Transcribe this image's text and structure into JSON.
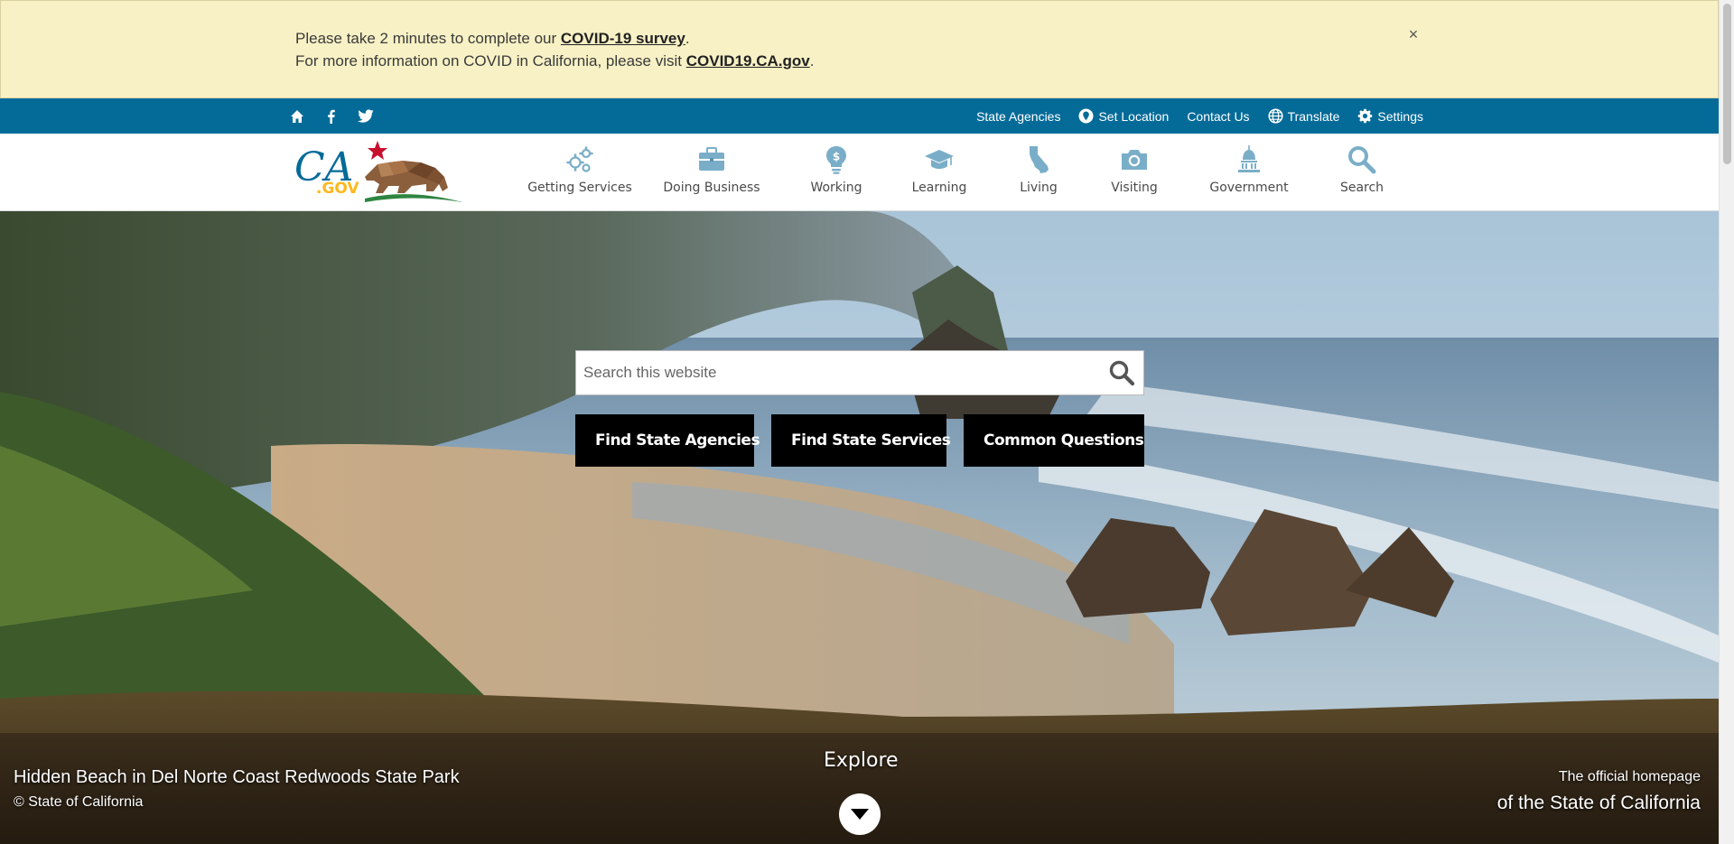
{
  "alert": {
    "line1_prefix": "Please take 2 minutes to complete our ",
    "line1_link": "COVID-19 survey",
    "line1_suffix": ".",
    "line2_prefix": "For more information on COVID in California, please visit ",
    "line2_link": "COVID19.CA.gov",
    "line2_suffix": ".",
    "close_symbol": "×"
  },
  "utility": {
    "social_icons": [
      "home-icon",
      "facebook-icon",
      "twitter-icon"
    ],
    "links": {
      "state_agencies": "State Agencies",
      "set_location": "Set Location",
      "contact_us": "Contact Us",
      "translate": "Translate",
      "settings": "Settings"
    }
  },
  "header": {
    "logo_text": "CA.GOV",
    "logo_ca": "CA",
    "logo_gov": ".GOV",
    "nav": [
      {
        "label": "Getting Services",
        "icon": "gears-icon"
      },
      {
        "label": "Doing Business",
        "icon": "briefcase-icon"
      },
      {
        "label": "Working",
        "icon": "lightbulb-dollar-icon"
      },
      {
        "label": "Learning",
        "icon": "graduation-cap-icon"
      },
      {
        "label": "Living",
        "icon": "california-icon"
      },
      {
        "label": "Visiting",
        "icon": "camera-icon"
      },
      {
        "label": "Government",
        "icon": "capitol-icon"
      },
      {
        "label": "Search",
        "icon": "search-icon"
      }
    ]
  },
  "hero": {
    "search_placeholder": "Search this website",
    "buttons": [
      {
        "label": "Find State Agencies",
        "icon": "pointer-icon"
      },
      {
        "label": "Find State Services",
        "icon": "people-icon"
      },
      {
        "label": "Common Questions",
        "icon": "lightbulb-icon"
      }
    ],
    "photo_title": "Hidden Beach in Del Norte Coast Redwoods State Park",
    "photo_credit": "© State of California",
    "explore_label": "Explore",
    "official_line1": "The official homepage",
    "official_line2": "of the State of California"
  },
  "colors": {
    "alert_bg": "#f7f1c5",
    "utility_bg": "#046b99",
    "nav_icon": "#7aaec8",
    "button_bg": "#000000"
  }
}
